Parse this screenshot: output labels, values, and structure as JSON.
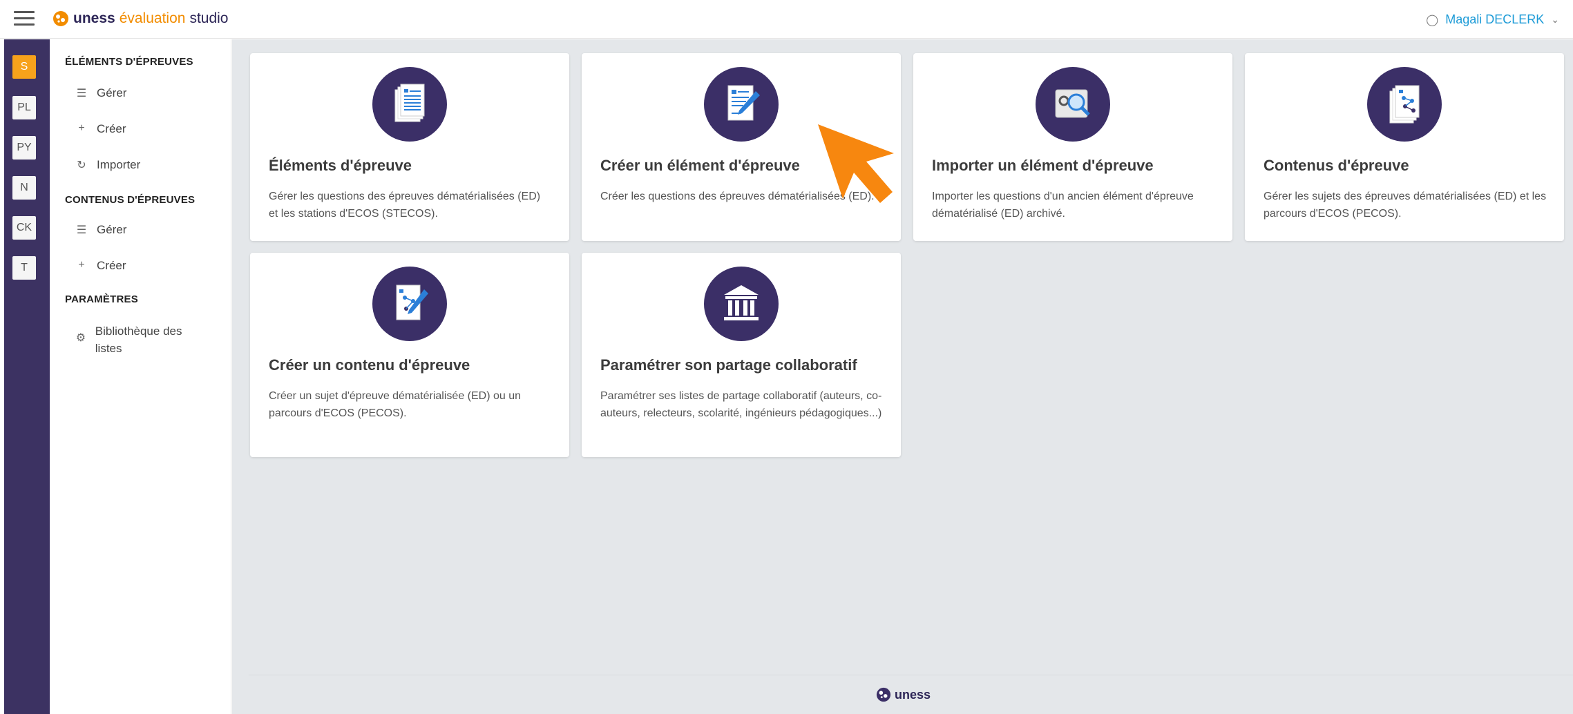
{
  "header": {
    "brand_uness": "uness",
    "brand_eval": "évaluation",
    "brand_studio": "studio",
    "user_name": "Magali DECLERK",
    "user_icon": "person-icon",
    "chevron_icon": "chevron-down-icon"
  },
  "rail": [
    {
      "label": "S",
      "active": true
    },
    {
      "label": "PL"
    },
    {
      "label": "PY"
    },
    {
      "label": "N"
    },
    {
      "label": "CK"
    },
    {
      "label": "T"
    }
  ],
  "sidebar": {
    "section1_title": "ÉLÉMENTS D'ÉPREUVES",
    "section1_items": [
      {
        "label": "Gérer",
        "icon": "list-icon"
      },
      {
        "label": "Créer",
        "icon": "plus-icon"
      },
      {
        "label": "Importer",
        "icon": "import-icon"
      }
    ],
    "section2_title": "CONTENUS D'ÉPREUVES",
    "section2_items": [
      {
        "label": "Gérer",
        "icon": "list-icon"
      },
      {
        "label": "Créer",
        "icon": "plus-icon"
      }
    ],
    "section3_title": "PARAMÈTRES",
    "section3_items": [
      {
        "label": "Bibliothèque des listes",
        "icon": "gear-icon"
      }
    ]
  },
  "cards": [
    {
      "title": "Éléments d'épreuve",
      "desc": "Gérer les questions des épreuves dématérialisées (ED) et les stations d'ECOS (STECOS).",
      "icon": "documents-icon"
    },
    {
      "title": "Créer un élément d'épreuve",
      "desc": "Créer les questions des épreuves dématérialisées (ED).",
      "icon": "document-edit-icon"
    },
    {
      "title": "Importer un élément d'épreuve",
      "desc": "Importer les questions d'un ancien élément d'épreuve dématérialisé (ED) archivé.",
      "icon": "import-search-icon"
    },
    {
      "title": "Contenus d'épreuve",
      "desc": "Gérer les sujets des épreuves dématérialisées (ED) et les parcours d'ECOS (PECOS).",
      "icon": "content-pages-icon"
    },
    {
      "title": "Créer un contenu d'épreuve",
      "desc": "Créer un sujet d'épreuve dématérialisée (ED) ou un parcours d'ECOS (PECOS).",
      "icon": "content-edit-icon"
    },
    {
      "title": "Paramétrer son partage collaboratif",
      "desc": "Paramétrer ses listes de partage collaboratif (auteurs, co-auteurs, relecteurs, scolarité, ingénieurs pédagogiques...)",
      "icon": "institution-icon"
    }
  ],
  "footer": {
    "logo_text": "uness"
  },
  "colors": {
    "rail_purple": "#3c3262",
    "accent_orange": "#f7a21b",
    "icon_circle": "#3b2f67",
    "user_link": "#1d9bd7"
  }
}
